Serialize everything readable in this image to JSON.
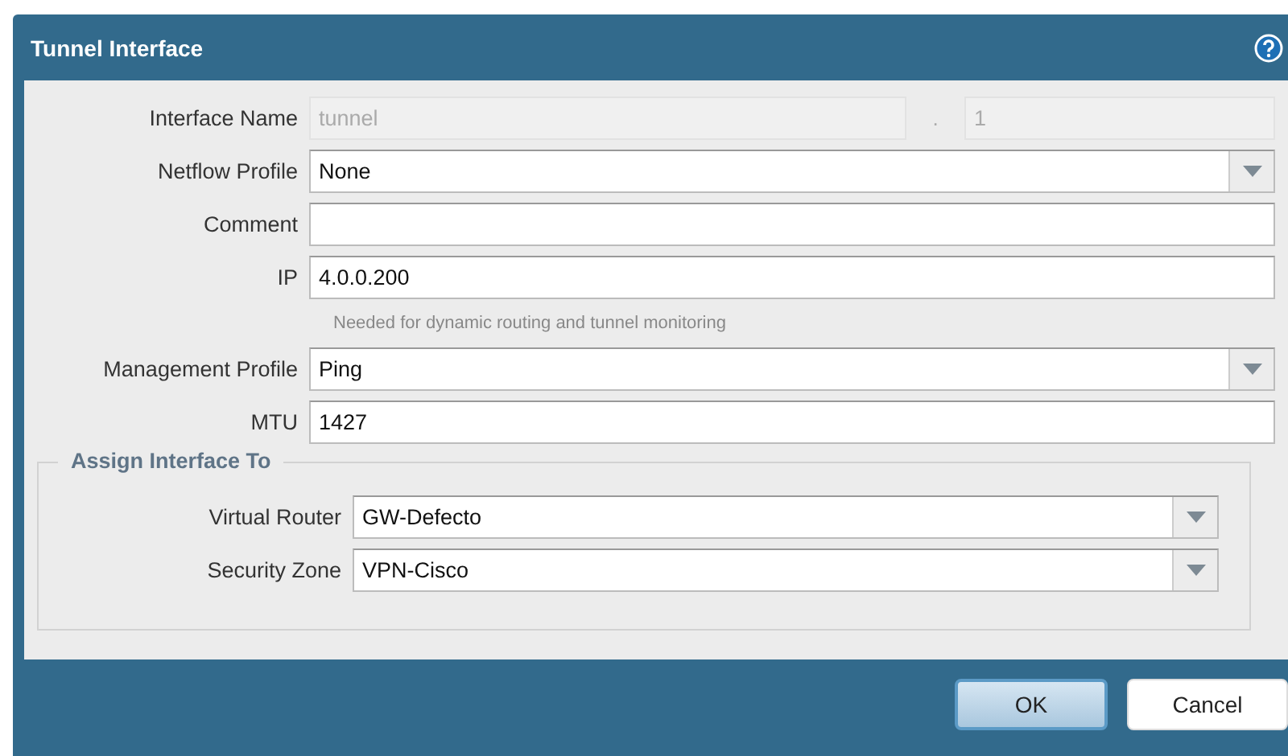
{
  "window": {
    "title": "Tunnel Interface"
  },
  "fields": [
    {
      "kind": "split",
      "label": "Interface Name",
      "value": "tunnel",
      "separator": ".",
      "suffix": "1",
      "disabled": true
    },
    {
      "kind": "select",
      "label": "Netflow Profile",
      "value": "None",
      "disabled": false
    },
    {
      "kind": "text",
      "label": "Comment",
      "disabled": false
    },
    {
      "kind": "text",
      "label": "IP",
      "value": "4.0.0.200",
      "hint": "Needed for dynamic routing and tunnel monitoring",
      "disabled": false
    },
    {
      "kind": "select",
      "label": "Management Profile",
      "value": "Ping",
      "disabled": false
    },
    {
      "kind": "text",
      "label": "MTU",
      "value": "1427",
      "disabled": false
    }
  ],
  "assign_group": {
    "title": "Assign Interface To",
    "fields": [
      {
        "kind": "select",
        "label": "Virtual Router",
        "value": "GW-Defecto",
        "disabled": false
      },
      {
        "kind": "select",
        "label": "Security Zone",
        "value": "VPN-Cisco",
        "disabled": false
      }
    ]
  },
  "buttons": [
    {
      "label": "OK",
      "primary": true
    },
    {
      "label": "Cancel",
      "primary": false
    }
  ]
}
